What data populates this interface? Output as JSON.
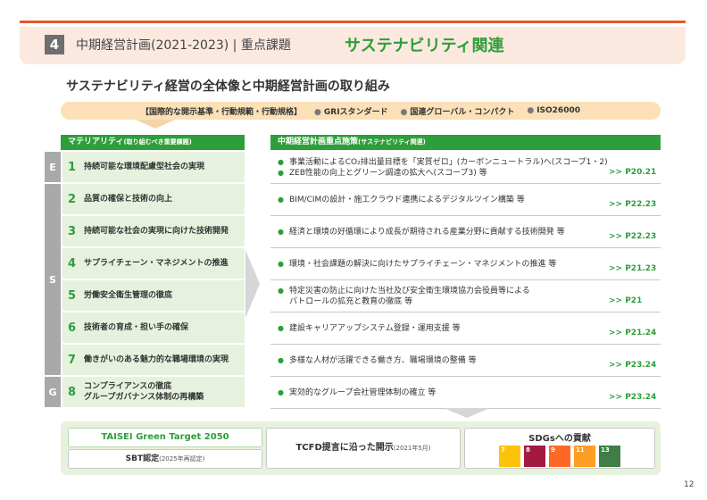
{
  "header": {
    "section_number": "4",
    "title": "中期経営計画(2021-2023) | 重点課題",
    "highlight": "サステナビリティ関連"
  },
  "subtitle": "サステナビリティ経営の全体像と中期経営計画の取り組み",
  "norms": {
    "label": "【国際的な開示基準・行動規範・行動規格】",
    "items": [
      "GRIスタンダード",
      "国連グローバル・コンパクト",
      "ISO26000"
    ]
  },
  "materiality": {
    "header": "マテリアリティ",
    "header_note": "(取り組むべき重要課題)",
    "groups": [
      "E",
      "S",
      "G"
    ],
    "rows": [
      {
        "num": "1",
        "label": "持続可能な環境配慮型社会の実現"
      },
      {
        "num": "2",
        "label": "品質の確保と技術の向上"
      },
      {
        "num": "3",
        "label": "持続可能な社会の実現に向けた技術開発"
      },
      {
        "num": "4",
        "label": "サプライチェーン・マネジメントの推進"
      },
      {
        "num": "5",
        "label": "労働安全衛生管理の徹底"
      },
      {
        "num": "6",
        "label": "技術者の育成・担い手の確保"
      },
      {
        "num": "7",
        "label": "働きがいのある魅力的な職場環境の実現"
      },
      {
        "num": "8",
        "label": "コンプライアンスの徹底",
        "label2": "グループガバナンス体制の再構築"
      }
    ]
  },
  "policies": {
    "header": "中期経営計画重点施策",
    "header_note": "(サステナビリティ関連)",
    "rows": [
      {
        "items": [
          "事業活動によるCO₂排出量目標を「実質ゼロ」(カーボンニュートラル)へ(スコープ1・2)",
          "ZEB性能の向上とグリーン調達の拡大へ(スコープ3) 等"
        ],
        "ref": ">> P20.21"
      },
      {
        "items": [
          "BIM/CIMの設計・施工クラウド連携によるデジタルツイン構築 等"
        ],
        "ref": ">> P22.23"
      },
      {
        "items": [
          "経済と環境の好循環により成長が期待される産業分野に貢献する技術開発 等"
        ],
        "ref": ">> P22.23"
      },
      {
        "items": [
          "環境・社会課題の解決に向けたサプライチェーン・マネジメントの推進 等"
        ],
        "ref": ">> P21.23"
      },
      {
        "items": [
          "特定災害の防止に向けた当社及び安全衛生環境協力会役員等による",
          "パトロールの拡充と教育の徹底 等"
        ],
        "ref": ">> P21"
      },
      {
        "items": [
          "建設キャリアアップシステム登録・運用支援 等"
        ],
        "ref": ">> P21.24"
      },
      {
        "items": [
          "多様な人材が活躍できる働き方、職場環境の整備 等"
        ],
        "ref": ">> P23.24"
      },
      {
        "items": [
          "実効的なグループ会社管理体制の確立 等"
        ],
        "ref": ">> P23.24"
      }
    ]
  },
  "bottom": {
    "taisei": "TAISEI Green Target 2050",
    "sbt": "SBT認定",
    "sbt_note": "(2025年再認定)",
    "tcfd": "TCFD提言に沿った開示",
    "tcfd_note": "(2021年5月)",
    "sdgs_title": "SDGsへの貢献",
    "sdg_icons": [
      {
        "num": "7",
        "color": "#fcc30b"
      },
      {
        "num": "8",
        "color": "#a21942"
      },
      {
        "num": "9",
        "color": "#fd6925"
      },
      {
        "num": "11",
        "color": "#fd9d24"
      },
      {
        "num": "13",
        "color": "#3f7e44"
      }
    ]
  },
  "page_number": "12"
}
